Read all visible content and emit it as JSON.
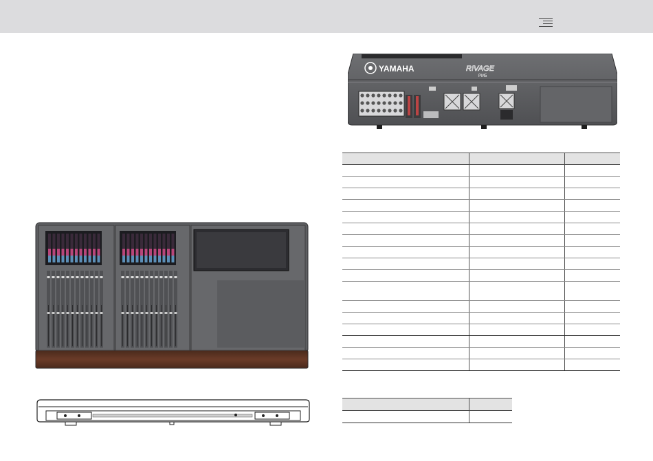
{
  "header": {
    "menu_icon": "hamburger-menu-icon"
  },
  "rear_panel": {
    "brand": "YAMAHA",
    "model_logo": "RIVAGE",
    "model_sub": "PM5"
  },
  "spec_table": {
    "columns": [
      "",
      "",
      ""
    ],
    "rows": [
      [
        "",
        "",
        ""
      ],
      [
        "",
        "",
        ""
      ],
      [
        "",
        "",
        ""
      ],
      [
        "",
        "",
        ""
      ],
      [
        "",
        "",
        ""
      ],
      [
        "",
        "",
        ""
      ],
      [
        "",
        "",
        ""
      ],
      [
        "",
        "",
        ""
      ],
      [
        "",
        "",
        ""
      ],
      [
        "",
        "",
        ""
      ],
      [
        "",
        "",
        ""
      ],
      [
        "",
        "",
        ""
      ],
      [
        "",
        "",
        ""
      ],
      [
        "",
        "",
        ""
      ],
      [
        "",
        "",
        ""
      ],
      [
        "",
        "",
        ""
      ],
      [
        "",
        "",
        ""
      ]
    ]
  },
  "small_table": {
    "columns": [
      "",
      ""
    ],
    "rows": [
      [
        "",
        ""
      ]
    ]
  },
  "colors": {
    "header_bg": "#dcdcde",
    "table_header_bg": "#e3e3e3",
    "panel_dark": "#5e5f62",
    "wood": "#5a3322"
  }
}
